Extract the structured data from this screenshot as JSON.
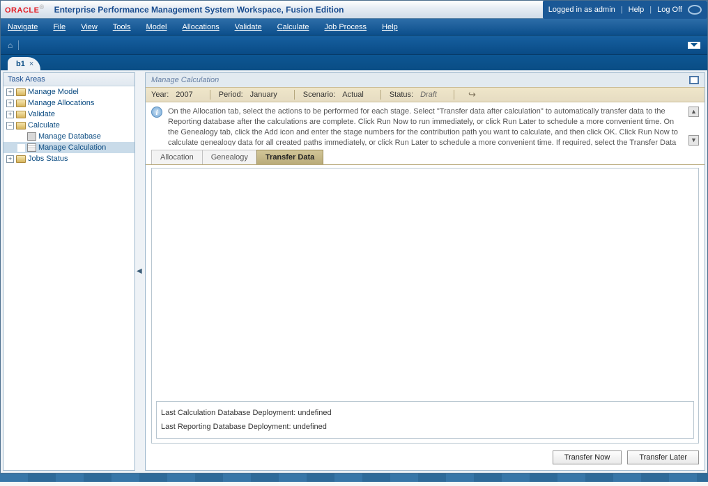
{
  "header": {
    "logo": "ORACLE",
    "title": "Enterprise Performance Management System Workspace, Fusion Edition",
    "logged_in": "Logged in as admin",
    "help": "Help",
    "logoff": "Log Off"
  },
  "menu": [
    "Navigate",
    "File",
    "View",
    "Tools",
    "Model",
    "Allocations",
    "Validate",
    "Calculate",
    "Job Process",
    "Help"
  ],
  "doc_tab": {
    "label": "b1",
    "close": "×"
  },
  "sidebar": {
    "title": "Task Areas",
    "items": [
      {
        "toggle": "+",
        "icon": "folder",
        "label": "Manage Model",
        "indent": 0
      },
      {
        "toggle": "+",
        "icon": "folder",
        "label": "Manage Allocations",
        "indent": 0
      },
      {
        "toggle": "+",
        "icon": "folder",
        "label": "Validate",
        "indent": 0
      },
      {
        "toggle": "−",
        "icon": "folder",
        "label": "Calculate",
        "indent": 0
      },
      {
        "toggle": "",
        "icon": "db",
        "label": "Manage Database",
        "indent": 1
      },
      {
        "toggle": "",
        "icon": "grid",
        "label": "Manage Calculation",
        "indent": 1,
        "selected": true
      },
      {
        "toggle": "+",
        "icon": "folder",
        "label": "Jobs Status",
        "indent": 0
      }
    ]
  },
  "main": {
    "title": "Manage Calculation",
    "filters": {
      "year_lbl": "Year:",
      "year": "2007",
      "period_lbl": "Period:",
      "period": "January",
      "scenario_lbl": "Scenario:",
      "scenario": "Actual",
      "status_lbl": "Status:",
      "status": "Draft"
    },
    "info": "On the Allocation tab, select the actions to be performed for each stage. Select \"Transfer data after calculation\" to automatically transfer data to the Reporting database after the calculations are complete. Click Run Now to run immediately, or click Run Later to schedule a more convenient time. On the Genealogy tab, click the Add icon and enter the stage numbers for the contribution path you want to calculate, and then click OK. Click Run Now to calculate genealogy data for all created paths immediately, or click Run Later to schedule a more convenient time. If required, select the Transfer Data tab and click Transfer Now to transfer",
    "tabs": [
      "Allocation",
      "Genealogy",
      "Transfer Data"
    ],
    "deploy": {
      "calc": "Last Calculation Database Deployment: undefined",
      "rep": "Last Reporting Database Deployment: undefined"
    },
    "buttons": {
      "now": "Transfer Now",
      "later": "Transfer Later"
    }
  }
}
